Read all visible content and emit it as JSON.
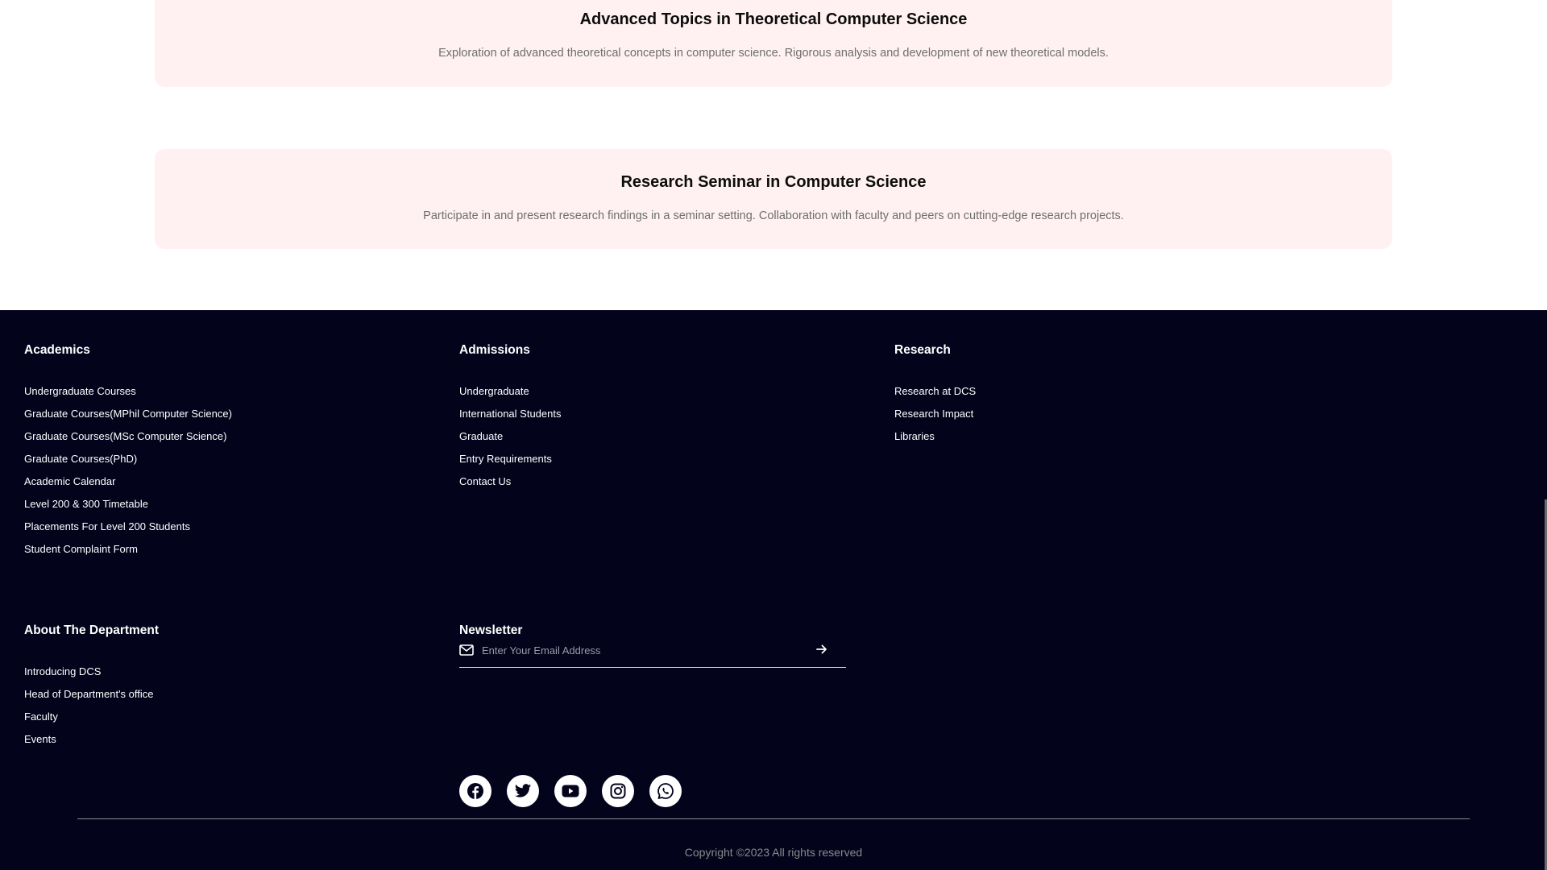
{
  "courses": [
    {
      "title": "Advanced Topics in Theoretical Computer Science",
      "description": "Exploration of advanced theoretical concepts in computer science. Rigorous analysis and development of new theoretical models."
    },
    {
      "title": "Research Seminar in Computer Science",
      "description": "Participate in and present research findings in a seminar setting. Collaboration with faculty and peers on cutting-edge research projects."
    }
  ],
  "footer": {
    "academics": {
      "heading": "Academics",
      "links": [
        "Undergraduate Courses",
        "Graduate Courses(MPhil Computer Science)",
        "Graduate Courses(MSc Computer Science)",
        "Graduate Courses(PhD)",
        "Academic Calendar",
        "Level 200 & 300 Timetable",
        "Placements For Level 200 Students",
        "Student Complaint Form"
      ]
    },
    "admissions": {
      "heading": "Admissions",
      "links": [
        "Undergraduate",
        "International Students",
        "Graduate",
        "Entry Requirements",
        "Contact Us"
      ]
    },
    "research": {
      "heading": "Research",
      "links": [
        "Research at DCS",
        "Research Impact",
        "Libraries"
      ]
    },
    "about": {
      "heading": "About The Department",
      "links": [
        "Introducing DCS",
        "Head of Department's office",
        "Faculty",
        "Events"
      ]
    },
    "newsletter": {
      "heading": "Newsletter",
      "email_placeholder": "Enter Your Email Address",
      "email_value": "",
      "icon": "envelope-icon",
      "submit_icon": "arrow-right-icon"
    },
    "social_icons": [
      "facebook-icon",
      "twitter-icon",
      "youtube-icon",
      "instagram-icon",
      "whatsapp-icon"
    ],
    "copyright": "Copyright ©2023 All rights reserved"
  },
  "colors": {
    "card_background": "#fff1f1",
    "footer_background": "#03031c",
    "text_white": "#ffffff",
    "muted_text": "#6e6e6e"
  }
}
